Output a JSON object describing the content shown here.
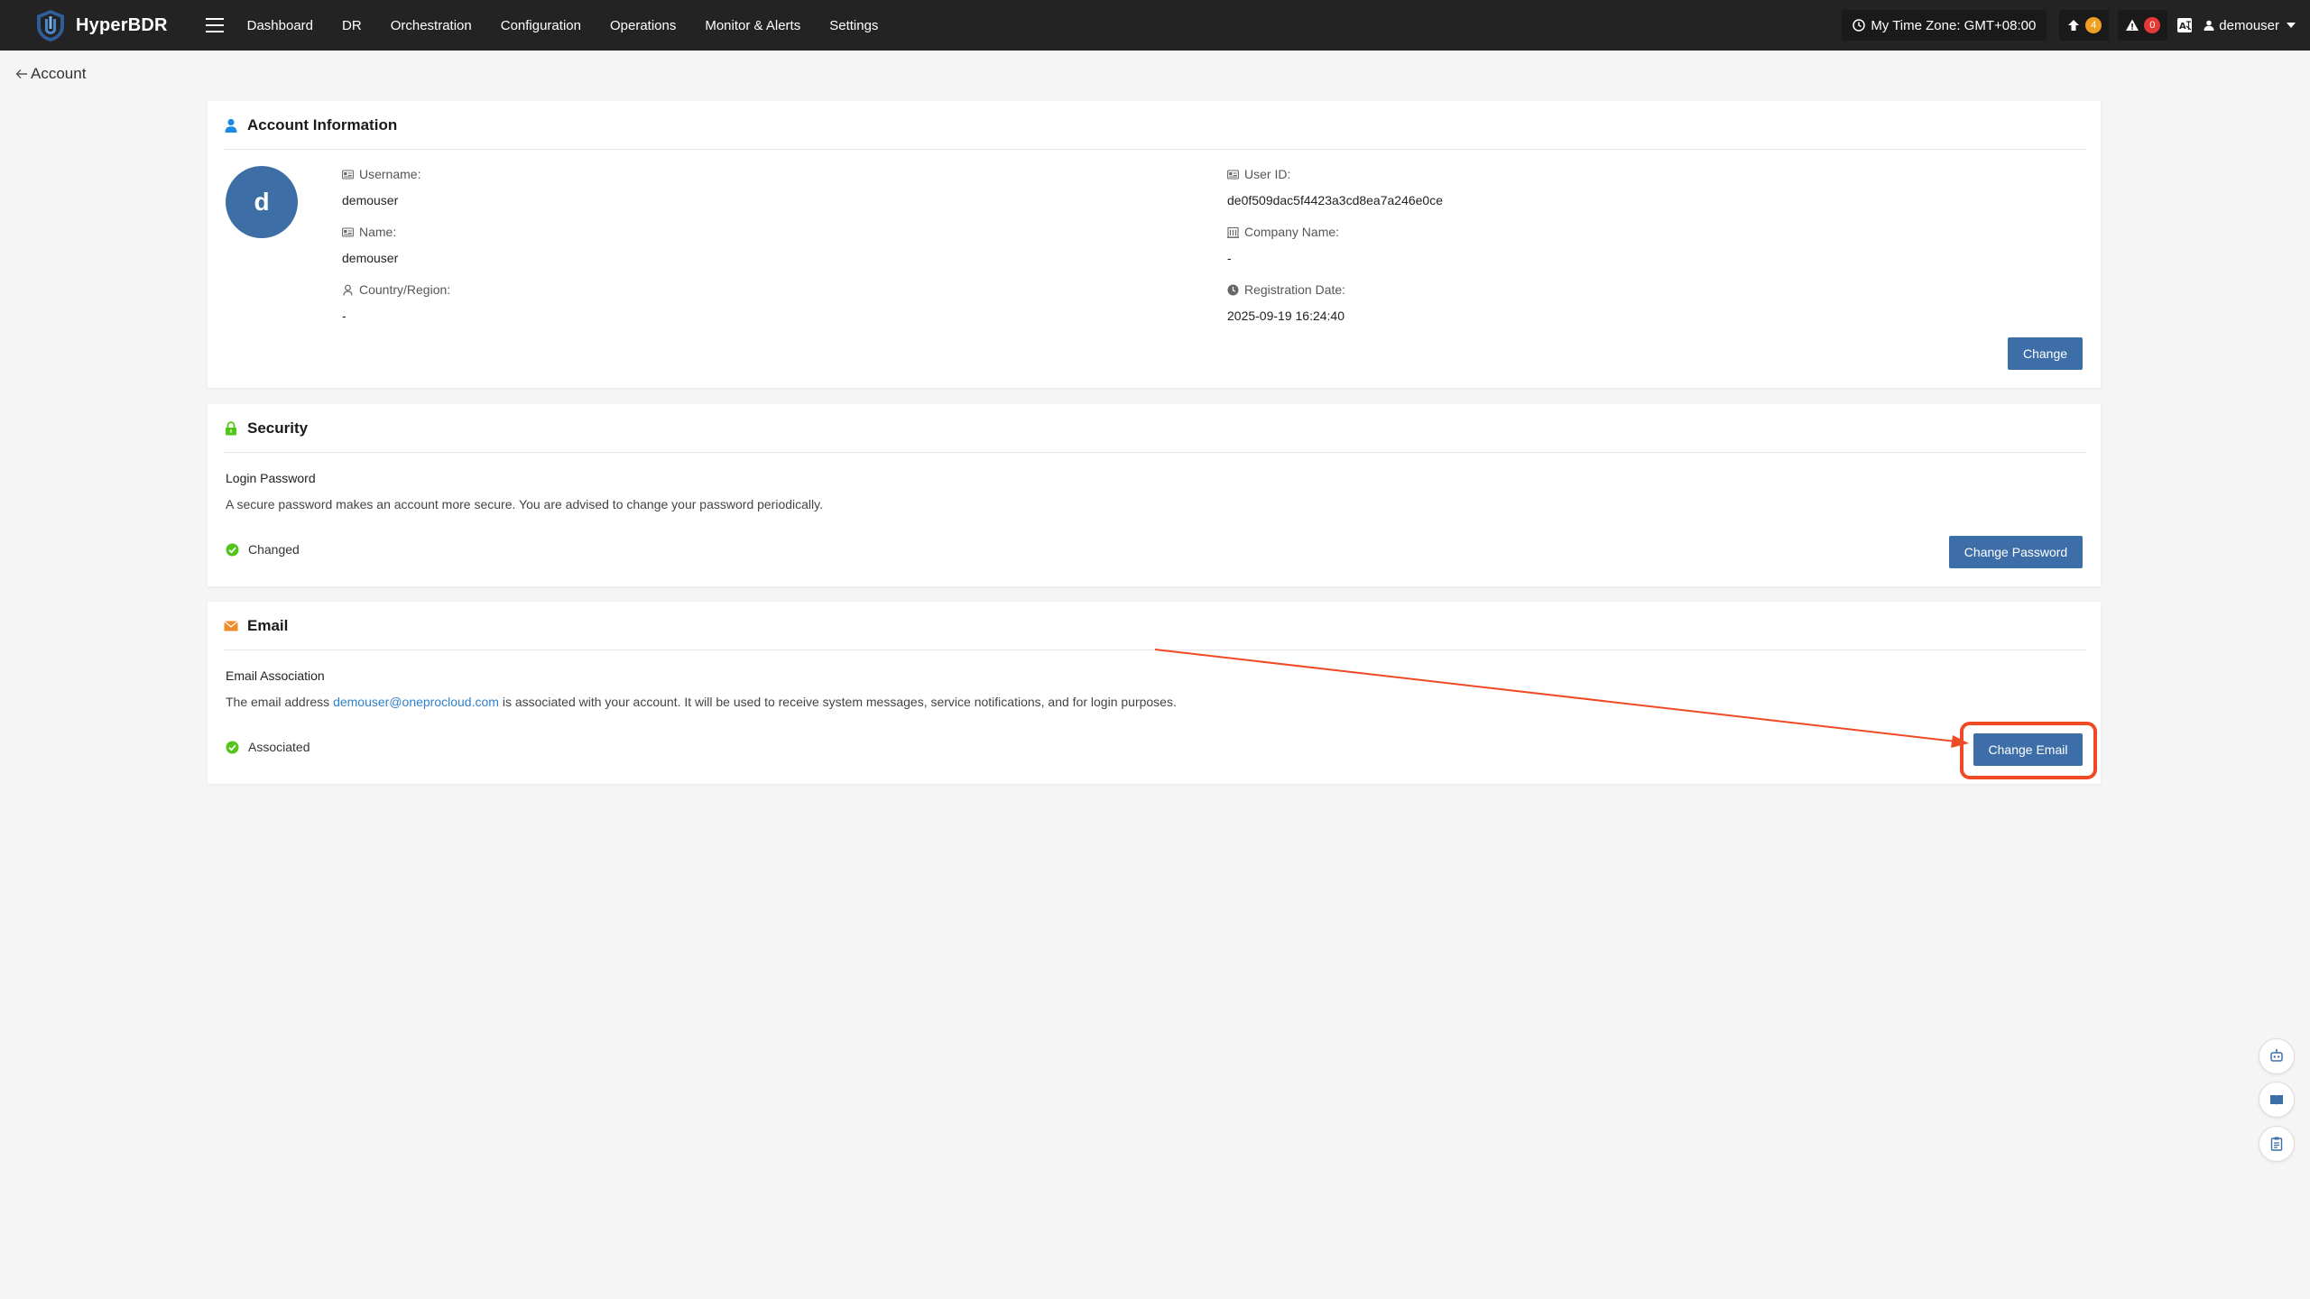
{
  "app": {
    "brand": "HyperBDR"
  },
  "nav": {
    "items": [
      "Dashboard",
      "DR",
      "Orchestration",
      "Configuration",
      "Operations",
      "Monitor & Alerts",
      "Settings"
    ]
  },
  "topbar": {
    "timezone": "My Time Zone: GMT+08:00",
    "upgrade_count": "4",
    "alert_count": "0",
    "username": "demouser"
  },
  "breadcrumb": {
    "back_label": "Account"
  },
  "account": {
    "title": "Account Information",
    "avatar_letter": "d",
    "username_label": "Username:",
    "username": "demouser",
    "name_label": "Name:",
    "name": "demouser",
    "country_label": "Country/Region:",
    "country": "-",
    "userid_label": "User ID:",
    "userid": "de0f509dac5f4423a3cd8ea7a246e0ce",
    "company_label": "Company Name:",
    "company": "-",
    "regdate_label": "Registration Date:",
    "regdate": "2025-09-19 16:24:40",
    "change_button": "Change"
  },
  "security": {
    "title": "Security",
    "item_title": "Login Password",
    "description": "A secure password makes an account more secure. You are advised to change your password periodically.",
    "status": "Changed",
    "button": "Change Password"
  },
  "email": {
    "title": "Email",
    "item_title": "Email Association",
    "desc_prefix": "The email address ",
    "address": "demouser@oneprocloud.com",
    "desc_suffix": " is associated with your account. It will be used to receive system messages, service notifications, and for login purposes.",
    "status": "Associated",
    "button": "Change Email"
  },
  "colors": {
    "topbar": "#232323",
    "primary_button": "#3e6ea8",
    "link": "#2f80c8",
    "success": "#52c41a",
    "annotation": "#f04a24",
    "email_icon": "#f08c2c"
  }
}
